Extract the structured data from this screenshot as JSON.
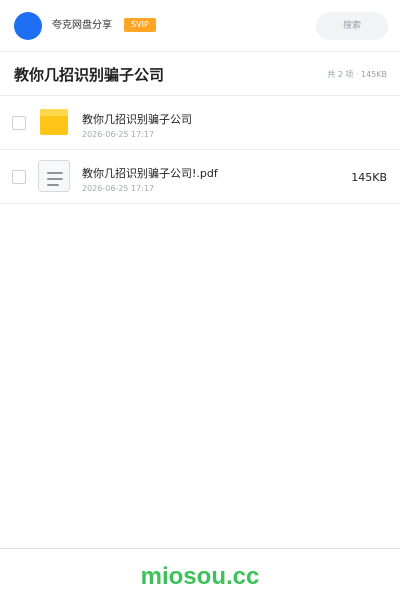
{
  "header": {
    "user_name": "夸克网盘分享",
    "badge": "SVIP",
    "search_placeholder": "搜索"
  },
  "title_bar": {
    "title": "教你几招识别骗子公司",
    "summary": "共 2 项 · 145KB"
  },
  "files": [
    {
      "type": "folder",
      "icon": "folder-icon",
      "name": "教你几招识别骗子公司",
      "date": "2026-06-25 17:17",
      "size": ""
    },
    {
      "type": "pdf",
      "icon": "document-icon",
      "name": "教你几招识别骗子公司!.pdf",
      "date": "2026-06-25 17:17",
      "size": "145KB"
    }
  ],
  "footer": {
    "logo_text": "miosou.cc"
  },
  "colors": {
    "avatar": "#1e6ff3",
    "badge": "#ffa424",
    "folder": "#ffc619",
    "logo": "#3ec15b"
  }
}
